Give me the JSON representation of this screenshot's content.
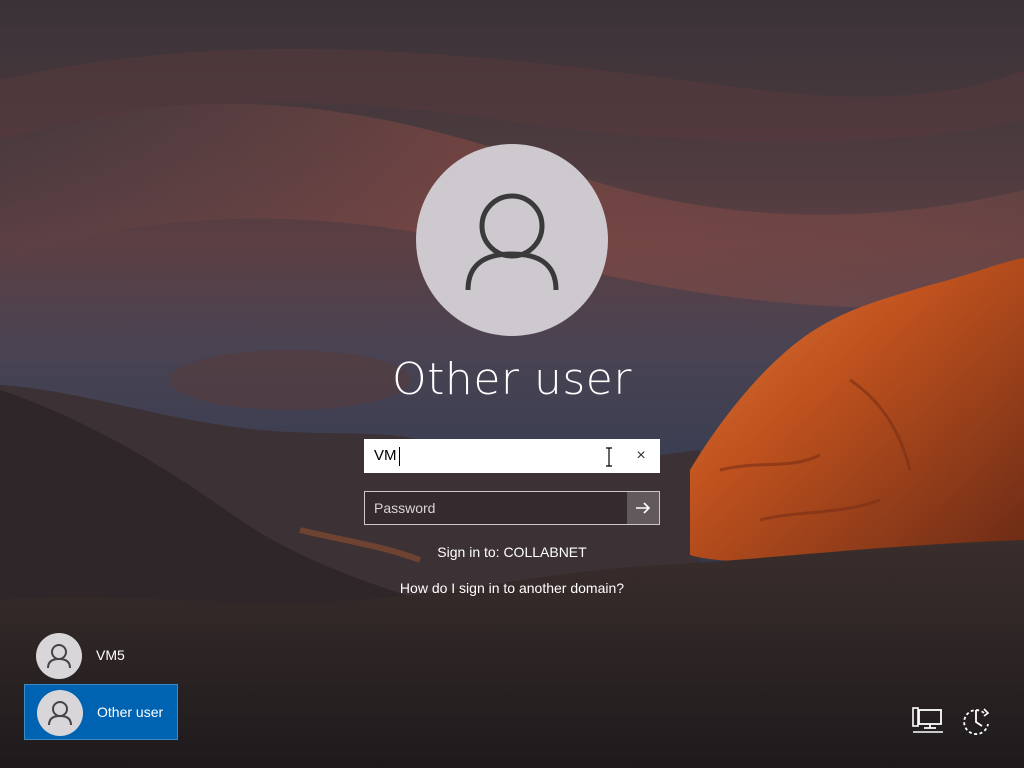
{
  "login": {
    "account_name": "Other user",
    "username_value": "VM",
    "clear_glyph": "×",
    "password_placeholder": "Password",
    "sign_in_to": "Sign in to: COLLABNET",
    "domain_help_link": "How do I sign in to another domain?"
  },
  "users": [
    {
      "name": "VM5",
      "selected": false
    },
    {
      "name": "Other user",
      "selected": true
    }
  ],
  "corner_icons": [
    "network-icon",
    "ease-of-access-icon"
  ],
  "colors": {
    "selected_tile": "#0063b1",
    "avatar": "#cdc9ce",
    "rock_orange": "#c0521e"
  }
}
